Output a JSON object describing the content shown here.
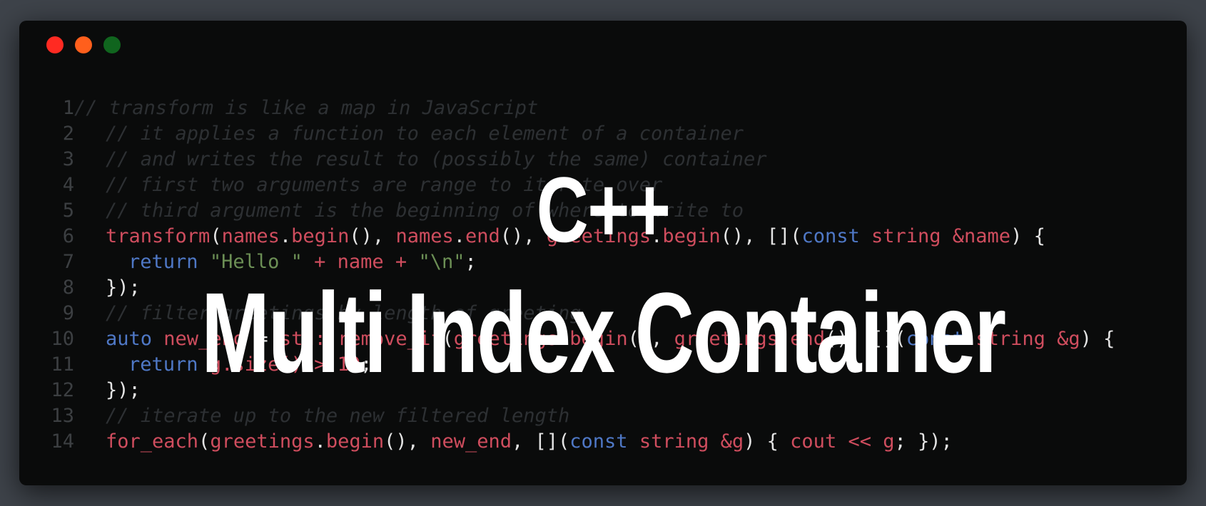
{
  "window": {
    "controls": [
      {
        "name": "close",
        "color": "#ff2a22"
      },
      {
        "name": "minimize",
        "color": "#ff5f1c"
      },
      {
        "name": "maximize",
        "color": "#10651e"
      }
    ]
  },
  "code_lines": [
    {
      "n": "1",
      "indent": 0,
      "tokens": [
        [
          "comment",
          "// transform is like a map in JavaScript"
        ]
      ]
    },
    {
      "n": "2",
      "indent": 1,
      "tokens": [
        [
          "comment",
          "// it applies a function to each element of a container"
        ]
      ]
    },
    {
      "n": "3",
      "indent": 1,
      "tokens": [
        [
          "comment",
          "// and writes the result to (possibly the same) container"
        ]
      ]
    },
    {
      "n": "4",
      "indent": 1,
      "tokens": [
        [
          "comment",
          "// first two arguments are range to iterate over"
        ]
      ]
    },
    {
      "n": "5",
      "indent": 1,
      "tokens": [
        [
          "comment",
          "// third argument is the beginning of where to write to"
        ]
      ]
    },
    {
      "n": "6",
      "indent": 1,
      "tokens": [
        [
          "fn",
          "transform"
        ],
        [
          "punct",
          "("
        ],
        [
          "ident",
          "names"
        ],
        [
          "punct",
          "."
        ],
        [
          "fn",
          "begin"
        ],
        [
          "punct",
          "(), "
        ],
        [
          "ident",
          "names"
        ],
        [
          "punct",
          "."
        ],
        [
          "fn",
          "end"
        ],
        [
          "punct",
          "(), "
        ],
        [
          "ident",
          "greetings"
        ],
        [
          "punct",
          "."
        ],
        [
          "fn",
          "begin"
        ],
        [
          "punct",
          "(), []("
        ],
        [
          "kw",
          "const"
        ],
        [
          "punct",
          " "
        ],
        [
          "ident",
          "string &name"
        ],
        [
          "punct",
          ") {"
        ]
      ]
    },
    {
      "n": "7",
      "indent": 2,
      "tokens": [
        [
          "kw",
          "return"
        ],
        [
          "punct",
          " "
        ],
        [
          "str",
          "\"Hello \""
        ],
        [
          "punct",
          " "
        ],
        [
          "ident",
          "+ name +"
        ],
        [
          "punct",
          " "
        ],
        [
          "str",
          "\"\\n\""
        ],
        [
          "punct",
          ";"
        ]
      ]
    },
    {
      "n": "8",
      "indent": 1,
      "tokens": [
        [
          "punct",
          "});"
        ]
      ]
    },
    {
      "n": "9",
      "indent": 1,
      "tokens": [
        [
          "comment",
          "// filter greetings by length of greeting"
        ]
      ]
    },
    {
      "n": "10",
      "indent": 1,
      "tokens": [
        [
          "kw",
          "auto"
        ],
        [
          "punct",
          " "
        ],
        [
          "ident",
          "new_end"
        ],
        [
          "punct",
          " = "
        ],
        [
          "ident",
          "std::remove_if"
        ],
        [
          "punct",
          "("
        ],
        [
          "ident",
          "greetings"
        ],
        [
          "punct",
          "."
        ],
        [
          "fn",
          "begin"
        ],
        [
          "punct",
          "(), "
        ],
        [
          "ident",
          "greetings"
        ],
        [
          "punct",
          "."
        ],
        [
          "fn",
          "end"
        ],
        [
          "punct",
          "(), []("
        ],
        [
          "kw",
          "const"
        ],
        [
          "punct",
          " "
        ],
        [
          "ident",
          "string &g"
        ],
        [
          "punct",
          ") {"
        ]
      ]
    },
    {
      "n": "11",
      "indent": 2,
      "tokens": [
        [
          "kw",
          "return"
        ],
        [
          "punct",
          " "
        ],
        [
          "ident",
          "g.size()"
        ],
        [
          "punct",
          " "
        ],
        [
          "ident",
          "> 10"
        ],
        [
          "punct",
          ";"
        ]
      ]
    },
    {
      "n": "12",
      "indent": 1,
      "tokens": [
        [
          "punct",
          "});"
        ]
      ]
    },
    {
      "n": "13",
      "indent": 1,
      "tokens": [
        [
          "comment",
          "// iterate up to the new filtered length"
        ]
      ]
    },
    {
      "n": "14",
      "indent": 1,
      "tokens": [
        [
          "fn",
          "for_each"
        ],
        [
          "punct",
          "("
        ],
        [
          "ident",
          "greetings"
        ],
        [
          "punct",
          "."
        ],
        [
          "fn",
          "begin"
        ],
        [
          "punct",
          "(), "
        ],
        [
          "ident",
          "new_end"
        ],
        [
          "punct",
          ", []("
        ],
        [
          "kw",
          "const"
        ],
        [
          "punct",
          " "
        ],
        [
          "ident",
          "string &g"
        ],
        [
          "punct",
          ") { "
        ],
        [
          "ident",
          "cout << g"
        ],
        [
          "punct",
          "; });"
        ]
      ]
    }
  ],
  "overlay": {
    "line1": "C++",
    "line2": "Multi Index Container"
  }
}
